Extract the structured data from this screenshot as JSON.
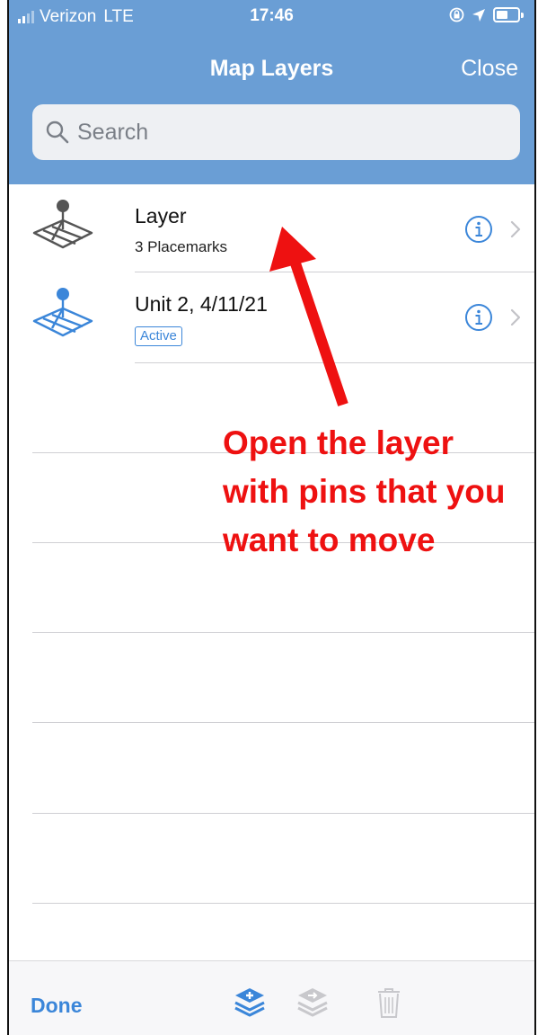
{
  "status_bar": {
    "carrier": "Verizon",
    "network": "LTE",
    "time": "17:46"
  },
  "nav": {
    "title": "Map Layers",
    "close_label": "Close"
  },
  "search": {
    "placeholder": "Search"
  },
  "layers": [
    {
      "title": "Layer",
      "subtitle": "3 Placemarks",
      "badge": ""
    },
    {
      "title": "Unit 2, 4/11/21",
      "subtitle": "",
      "badge": "Active"
    }
  ],
  "annotation": {
    "text": "Open the layer with pins that you want to move",
    "color": "#ee1111"
  },
  "toolbar": {
    "done_label": "Done",
    "icons": [
      "add-layer-icon",
      "import-layer-icon",
      "trash-icon"
    ]
  },
  "colors": {
    "header": "#6a9ed5",
    "accent": "#3b86d9",
    "layer_icon_default": "#555555",
    "layer_icon_active": "#3b86d9"
  }
}
